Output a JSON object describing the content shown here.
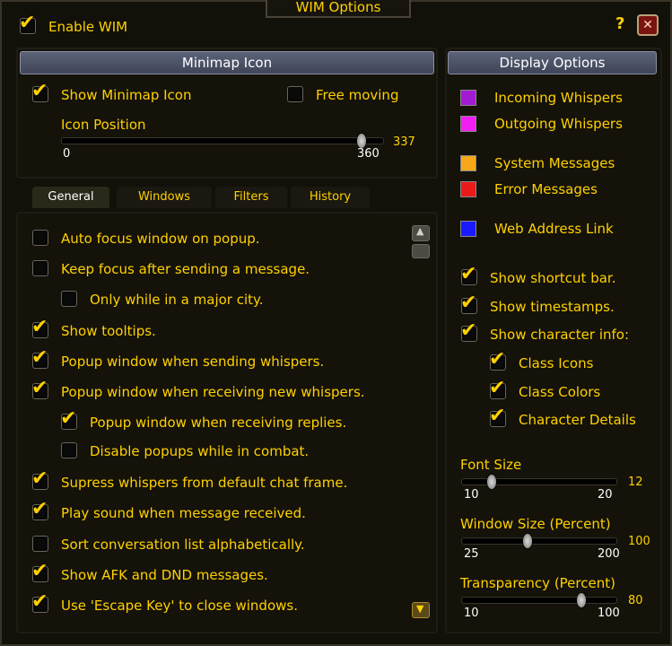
{
  "window": {
    "title": "WIM Options",
    "help": "?",
    "close": "✕"
  },
  "enable": {
    "label": "Enable WIM",
    "checked": true
  },
  "minimap": {
    "header": "Minimap Icon",
    "show_icon": "Show Minimap Icon",
    "free_moving": "Free moving",
    "position_label": "Icon Position",
    "min": "0",
    "max": "360",
    "value": "337",
    "value_num": 337,
    "range": [
      0,
      360
    ]
  },
  "tabs": [
    "General",
    "Windows",
    "Filters",
    "History"
  ],
  "general_options": [
    {
      "label": "Auto focus window on popup.",
      "checked": false,
      "indent": 0
    },
    {
      "label": "Keep focus after sending a message.",
      "checked": false,
      "indent": 0
    },
    {
      "label": "Only while in a major city.",
      "checked": false,
      "indent": 1
    },
    {
      "label": "Show tooltips.",
      "checked": true,
      "indent": 0
    },
    {
      "label": "Popup window when sending whispers.",
      "checked": true,
      "indent": 0
    },
    {
      "label": "Popup window when receiving new whispers.",
      "checked": true,
      "indent": 0
    },
    {
      "label": "Popup window when receiving replies.",
      "checked": true,
      "indent": 1
    },
    {
      "label": "Disable popups while in combat.",
      "checked": false,
      "indent": 1
    },
    {
      "label": "Supress whispers from default chat frame.",
      "checked": true,
      "indent": 0
    },
    {
      "label": "Play sound when message received.",
      "checked": true,
      "indent": 0
    },
    {
      "label": "Sort conversation list alphabetically.",
      "checked": false,
      "indent": 0
    },
    {
      "label": "Show AFK and DND messages.",
      "checked": true,
      "indent": 0
    },
    {
      "label": "Use 'Escape Key' to close windows.",
      "checked": true,
      "indent": 0
    }
  ],
  "display": {
    "header": "Display Options",
    "colors": [
      {
        "label": "Incoming Whispers",
        "color": "#a21bd4"
      },
      {
        "label": "Outgoing Whispers",
        "color": "#f21ff2"
      },
      {
        "label": "System Messages",
        "color": "#f6a81a"
      },
      {
        "label": "Error Messages",
        "color": "#ea1a1a"
      },
      {
        "label": "Web Address Link",
        "color": "#1a1aff"
      }
    ],
    "toggles": [
      {
        "label": "Show shortcut bar.",
        "checked": true,
        "indent": 0
      },
      {
        "label": "Show timestamps.",
        "checked": true,
        "indent": 0
      },
      {
        "label": "Show character info:",
        "checked": true,
        "indent": 0
      },
      {
        "label": "Class Icons",
        "checked": true,
        "indent": 1
      },
      {
        "label": "Class Colors",
        "checked": true,
        "indent": 1
      },
      {
        "label": "Character Details",
        "checked": true,
        "indent": 1
      }
    ],
    "sliders": [
      {
        "label": "Font Size",
        "min": "10",
        "max": "20",
        "value": "12",
        "value_num": 12,
        "range": [
          10,
          20
        ]
      },
      {
        "label": "Window Size (Percent)",
        "min": "25",
        "max": "200",
        "value": "100",
        "value_num": 100,
        "range": [
          25,
          200
        ]
      },
      {
        "label": "Transparency (Percent)",
        "min": "10",
        "max": "100",
        "value": "80",
        "value_num": 80,
        "range": [
          10,
          100
        ]
      }
    ]
  }
}
